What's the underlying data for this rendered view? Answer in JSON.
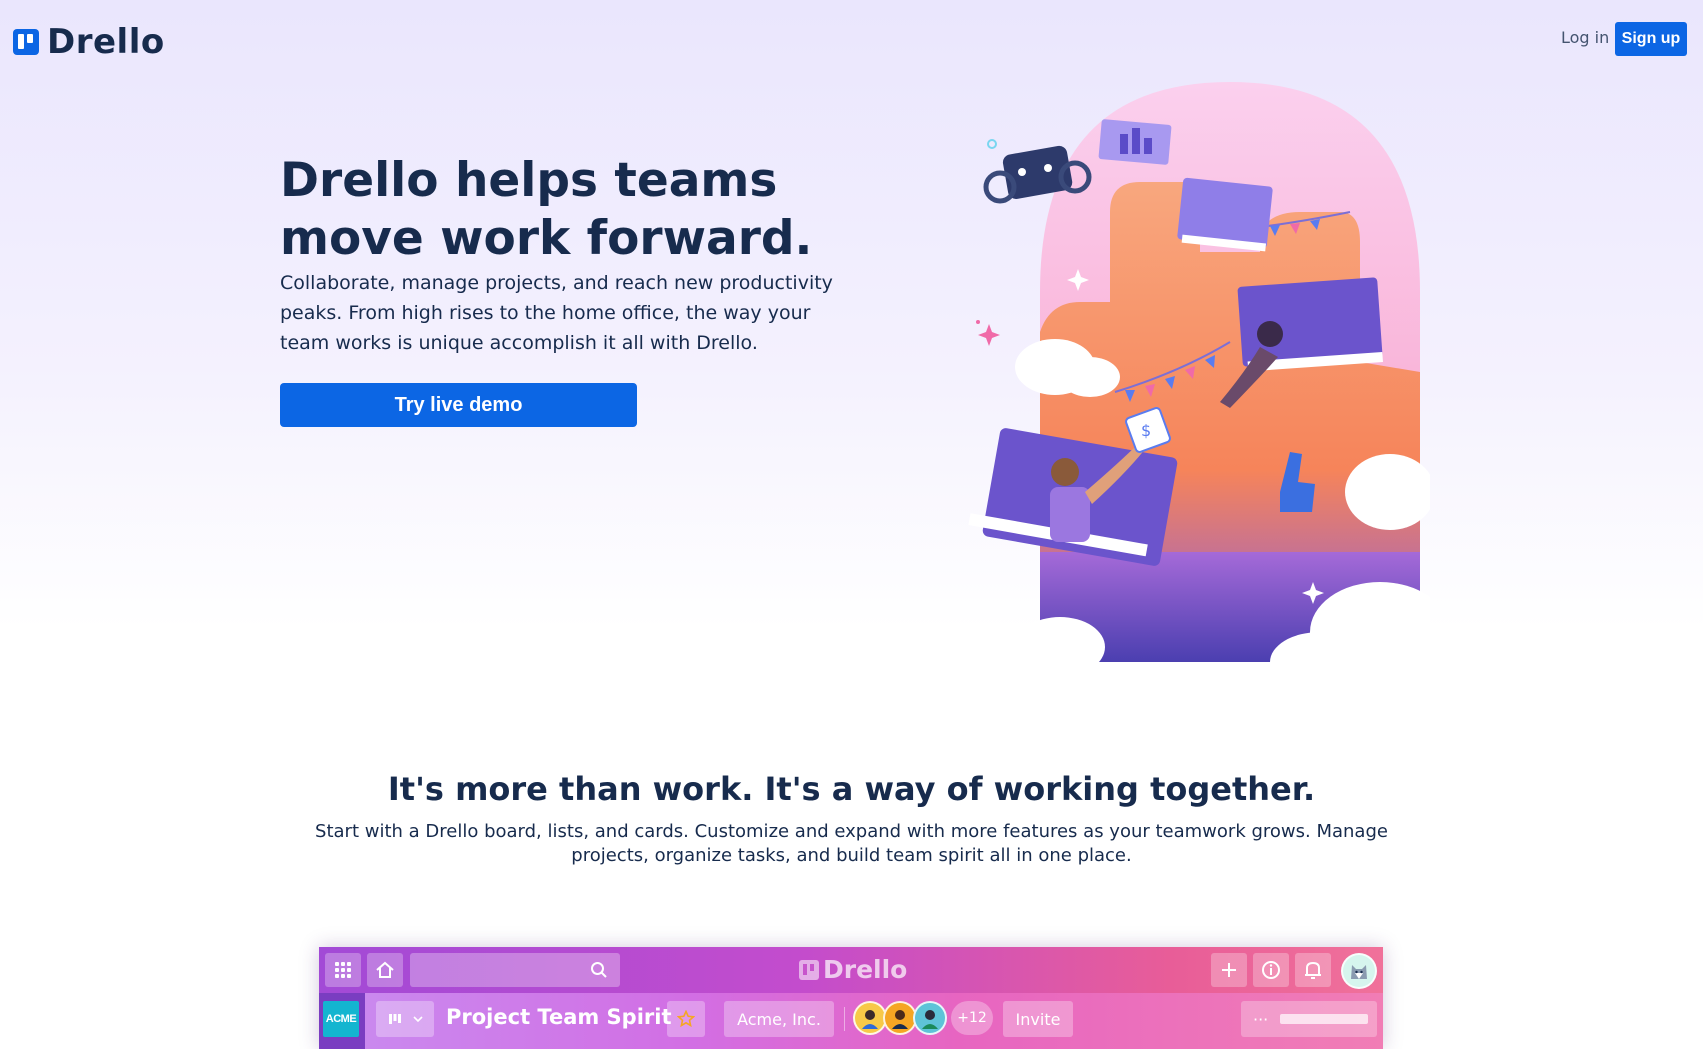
{
  "header": {
    "logo_text": "Drello",
    "login_label": "Log in",
    "signup_label": "Sign up"
  },
  "hero": {
    "title": "Drello helps teams move work forward.",
    "description": "Collaborate, manage projects, and reach new productivity peaks. From high rises to the home office, the way your team works is unique accomplish it all with Drello.",
    "cta_label": "Try live demo"
  },
  "section": {
    "title": "It's more than work. It's a way of working together.",
    "description": "Start with a Drello board, lists, and cards. Customize and expand with more features as your teamwork grows. Manage projects, organize tasks, and build team spirit all in one place."
  },
  "app_preview": {
    "logo_text": "Drello",
    "workspace_badge": "ACME",
    "board_title": "Project Team Spirit",
    "org_label": "Acme, Inc.",
    "more_members": "+12",
    "invite_label": "Invite",
    "menu_dots": "···"
  },
  "colors": {
    "brand": "#0c66e4",
    "text": "#172b4d"
  }
}
